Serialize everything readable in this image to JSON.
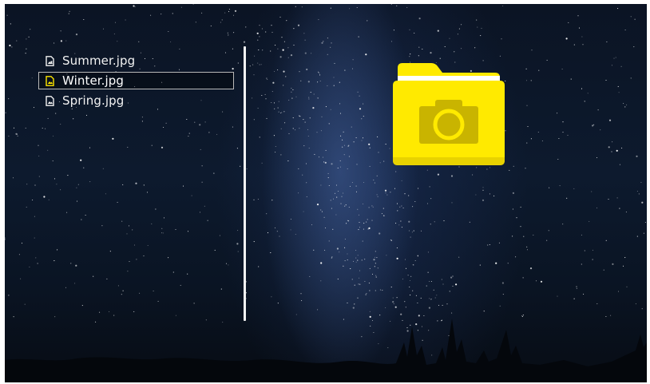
{
  "files": [
    {
      "name": "Summer.jpg",
      "icon": "image-file-icon",
      "selected": false
    },
    {
      "name": "Winter.jpg",
      "icon": "image-file-icon",
      "selected": true
    },
    {
      "name": "Spring.jpg",
      "icon": "image-file-icon",
      "selected": false
    }
  ],
  "preview": {
    "icon": "camera-folder-icon"
  },
  "colors": {
    "accent": "#ffe600",
    "folder": "#ffea00",
    "folder_tab": "#f0d800",
    "camera": "#c9b400",
    "text": "#f2f2f2",
    "selection_border": "#b9b9b9",
    "divider": "#f4f4f4"
  }
}
